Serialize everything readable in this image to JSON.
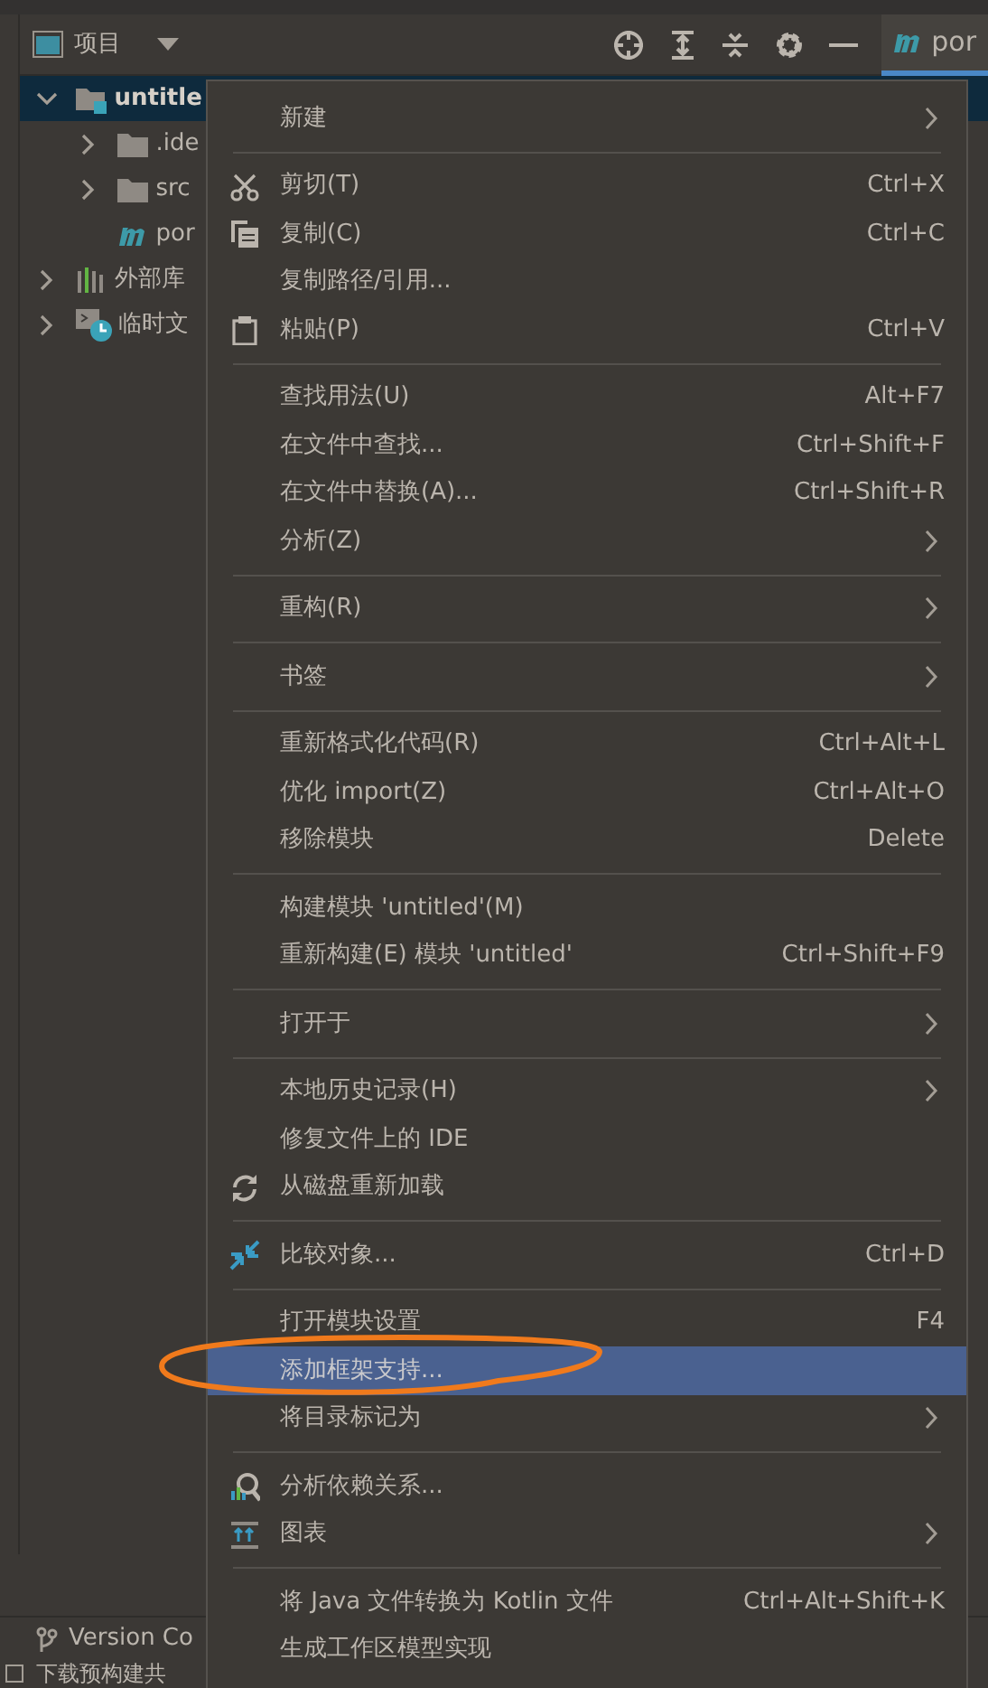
{
  "toolbar": {
    "title": "项目",
    "tab": "por"
  },
  "tree": [
    {
      "label": "untitle",
      "kind": "module",
      "expanded": true,
      "selected": true,
      "children": [
        {
          "label": ".ide",
          "kind": "folder",
          "expanded": false,
          "selected": false
        },
        {
          "label": "src",
          "kind": "folder",
          "expanded": false,
          "selected": false
        },
        {
          "label": "por",
          "kind": "maven",
          "selected": false
        }
      ]
    },
    {
      "label": "外部库",
      "kind": "library",
      "expanded": false,
      "selected": false
    },
    {
      "label": "临时文",
      "kind": "scratch",
      "expanded": false,
      "selected": false
    }
  ],
  "bottom_tool": "Version Co",
  "status_bar": "下载预构建共",
  "menu": {
    "groups": [
      [
        {
          "label": "新建",
          "submenu": true,
          "selected": false
        }
      ],
      [
        {
          "label": "剪切(T)",
          "shortcut": "Ctrl+X",
          "kind": "scissors",
          "selected": false
        },
        {
          "label": "复制(C)",
          "shortcut": "Ctrl+C",
          "kind": "copy",
          "selected": false
        },
        {
          "label": "复制路径/引用...",
          "selected": false
        },
        {
          "label": "粘贴(P)",
          "shortcut": "Ctrl+V",
          "kind": "clipboard",
          "selected": false
        }
      ],
      [
        {
          "label": "查找用法(U)",
          "shortcut": "Alt+F7",
          "selected": false
        },
        {
          "label": "在文件中查找...",
          "shortcut": "Ctrl+Shift+F",
          "selected": false
        },
        {
          "label": "在文件中替换(A)...",
          "shortcut": "Ctrl+Shift+R",
          "selected": false
        },
        {
          "label": "分析(Z)",
          "submenu": true,
          "selected": false
        }
      ],
      [
        {
          "label": "重构(R)",
          "submenu": true,
          "selected": false
        }
      ],
      [
        {
          "label": "书签",
          "submenu": true,
          "selected": false
        }
      ],
      [
        {
          "label": "重新格式化代码(R)",
          "shortcut": "Ctrl+Alt+L",
          "selected": false
        },
        {
          "label": "优化 import(Z)",
          "shortcut": "Ctrl+Alt+O",
          "selected": false
        },
        {
          "label": "移除模块",
          "shortcut": "Delete",
          "selected": false
        }
      ],
      [
        {
          "label": "构建模块 'untitled'(M)",
          "selected": false
        },
        {
          "label": "重新构建(E) 模块 'untitled'",
          "shortcut": "Ctrl+Shift+F9",
          "selected": false
        }
      ],
      [
        {
          "label": "打开于",
          "submenu": true,
          "selected": false
        }
      ],
      [
        {
          "label": "本地历史记录(H)",
          "submenu": true,
          "selected": false
        },
        {
          "label": "修复文件上的 IDE",
          "selected": false
        },
        {
          "label": "从磁盘重新加载",
          "kind": "reload",
          "selected": false
        }
      ],
      [
        {
          "label": "比较对象...",
          "shortcut": "Ctrl+D",
          "kind": "compare",
          "selected": false
        }
      ],
      [
        {
          "label": "打开模块设置",
          "shortcut": "F4",
          "selected": false
        },
        {
          "label": "添加框架支持...",
          "selected": true
        },
        {
          "label": "将目录标记为",
          "submenu": true,
          "selected": false
        }
      ],
      [
        {
          "label": "分析依赖关系...",
          "kind": "deps",
          "selected": false
        },
        {
          "label": "图表",
          "kind": "diagram",
          "submenu": true,
          "selected": false
        }
      ],
      [
        {
          "label": "将 Java 文件转换为 Kotlin 文件",
          "shortcut": "Ctrl+Alt+Shift+K",
          "selected": false
        },
        {
          "label": "生成工作区模型实现",
          "selected": false
        }
      ]
    ]
  }
}
